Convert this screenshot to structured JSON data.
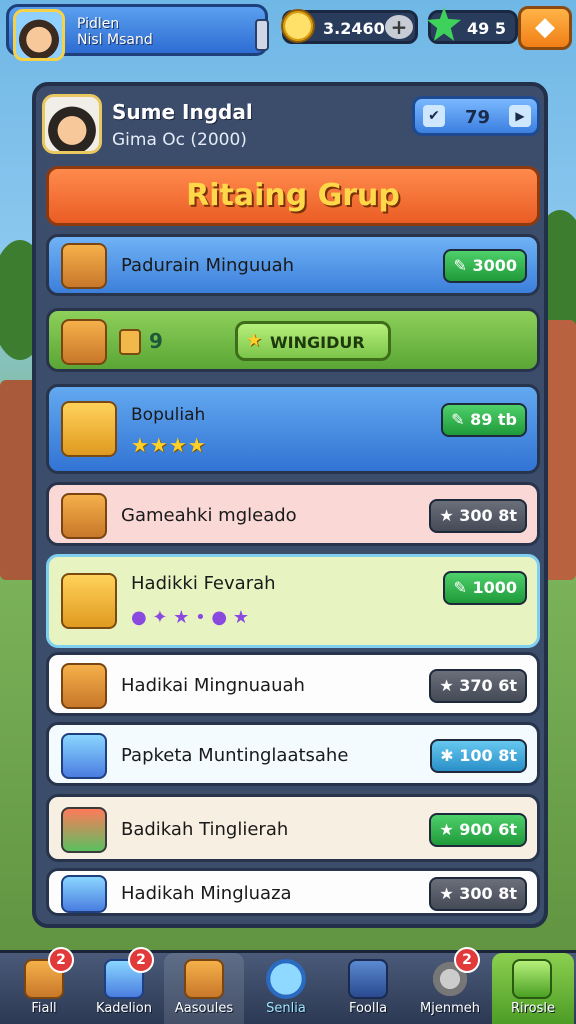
{
  "top": {
    "profile_line1": "Pidlen",
    "profile_line2": "Nisl Msand",
    "coins": "3.2460",
    "gems": "49 5"
  },
  "panel": {
    "player_name": "Sume Ingdal",
    "player_sub": "Gima Oc (2000)",
    "level": "79",
    "title": "Ritaing Grup"
  },
  "rows": [
    {
      "label": "Padurain Minguuah",
      "price": "3000"
    },
    {
      "chip_count": "9",
      "chip_label": "WINGIDUR"
    },
    {
      "label": "Bopuliah",
      "stars": "★★★★",
      "price": "89 tb"
    },
    {
      "label": "Gameahki mgleado",
      "price": "300 8t"
    },
    {
      "label": "Hadikki Fevarah",
      "gems_line": "● ✦ ★ • ● ★",
      "price": "1000"
    },
    {
      "label": "Hadikai Mingnuauah",
      "price": "370 6t"
    },
    {
      "label": "Papketa Muntinglaatsahe",
      "price": "100 8t"
    },
    {
      "label": "Badikah Tinglierah",
      "price": "900 6t"
    },
    {
      "label": "Hadikah Mingluaza",
      "price": "300 8t"
    }
  ],
  "nav": [
    {
      "label": "Fiall",
      "badge": "2"
    },
    {
      "label": "Kadelion",
      "badge": "2"
    },
    {
      "label": "Aasoules"
    },
    {
      "label": "Senlia"
    },
    {
      "label": "Foolla"
    },
    {
      "label": "Mjenmeh",
      "badge": "2"
    },
    {
      "label": "Rirosle"
    }
  ],
  "colors": {
    "accent": "#ea5d25",
    "title_text": "#ffd84a",
    "panel": "#3c4d6c",
    "active_nav": "#4a9a24"
  }
}
